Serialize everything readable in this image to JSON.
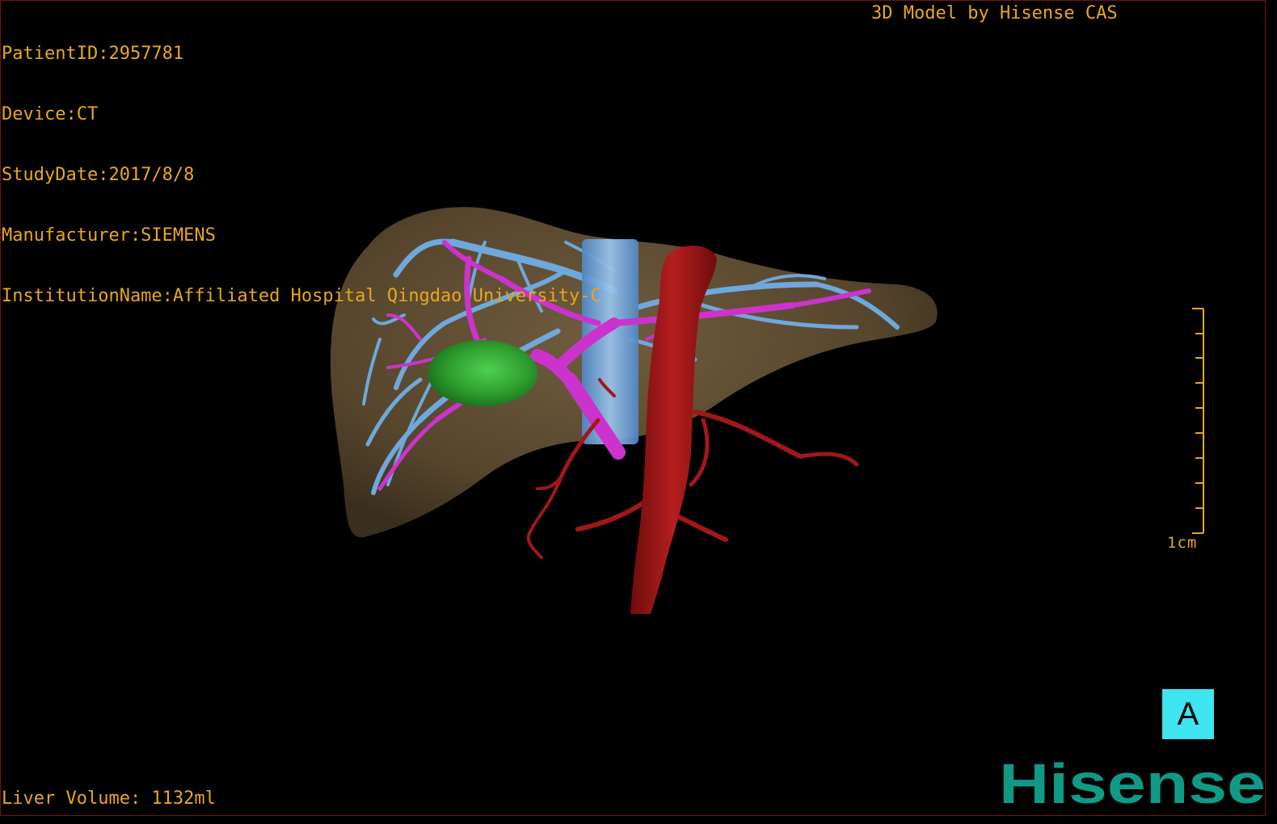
{
  "overlay": {
    "patient_id": "PatientID:2957781",
    "device": "Device:CT",
    "study_date": "StudyDate:2017/8/8",
    "manufacturer": "Manufacturer:SIEMENS",
    "institution": "InstitutionName:Affiliated Hospital Qingdao University-C",
    "model_credit": "3D Model by Hisense CAS",
    "liver_volume": "Liver Volume: 1132ml",
    "scale_label": "1cm",
    "view_label": "A",
    "logo_text": "Hisense"
  },
  "colors": {
    "overlay_text": "#e8a71c",
    "liver": "#6e5a3a",
    "hepatic_vein": "#6fa8dc",
    "portal_vein": "#cc33cc",
    "artery": "#a01818",
    "lesion": "#2e9e2e",
    "view_label_bg": "#3ee4ef",
    "logo": "#0f9a86"
  }
}
